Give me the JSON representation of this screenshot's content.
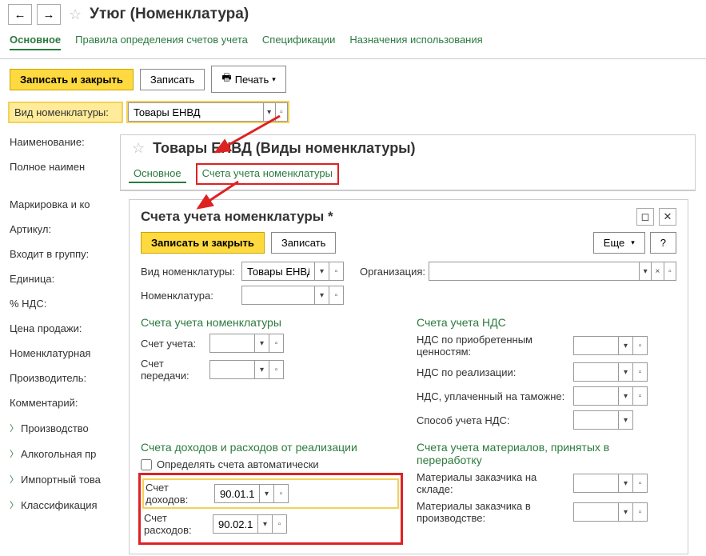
{
  "nav": {
    "back": "←",
    "forward": "→"
  },
  "main": {
    "title": "Утюг (Номенклатура)",
    "tabs": [
      "Основное",
      "Правила определения счетов учета",
      "Спецификации",
      "Назначения использования"
    ],
    "save_close": "Записать и закрыть",
    "save": "Записать",
    "print": "Печать",
    "type_label": "Вид номенклатуры:",
    "type_value": "Товары ЕНВД",
    "left_labels": [
      "Наименование:",
      "Полное наимен",
      "",
      "Маркировка и ко",
      "Артикул:",
      "Входит в группу:",
      "Единица:",
      "% НДС:",
      "Цена продажи:",
      "Номенклатурная",
      "Производитель:",
      "Комментарий:"
    ],
    "tree": [
      "Производство",
      "Алкогольная пр",
      "Импортный това",
      "Классификация"
    ]
  },
  "sub": {
    "title": "Товары ЕНВД (Виды номенклатуры)",
    "tab1": "Основное",
    "tab2": "Счета учета номенклатуры"
  },
  "inner": {
    "title": "Счета учета номенклатуры *",
    "save_close": "Записать и закрыть",
    "save": "Записать",
    "more": "Еще",
    "type_label": "Вид номенклатуры:",
    "type_value": "Товары ЕНВД",
    "nom_label": "Номенклатура:",
    "org_label": "Организация:",
    "sec_accounts": "Счета учета номенклатуры",
    "acc_label": "Счет учета:",
    "transfer_label": "Счет передачи:",
    "sec_nds": "Счета учета НДС",
    "nds_buy": "НДС по приобретенным ценностям:",
    "nds_sell": "НДС по реализации:",
    "nds_customs": "НДС, уплаченный на таможне:",
    "nds_method": "Способ учета НДС:",
    "sec_income": "Счета доходов и расходов от реализации",
    "auto_label": "Определять счета автоматически",
    "income_label": "Счет доходов:",
    "income_value": "90.01.1",
    "expense_label": "Счет расходов:",
    "expense_value": "90.02.1",
    "sec_materials": "Счета учета материалов, принятых в переработку",
    "mat_stock": "Материалы заказчика на складе:",
    "mat_prod": "Материалы заказчика в производстве:"
  }
}
